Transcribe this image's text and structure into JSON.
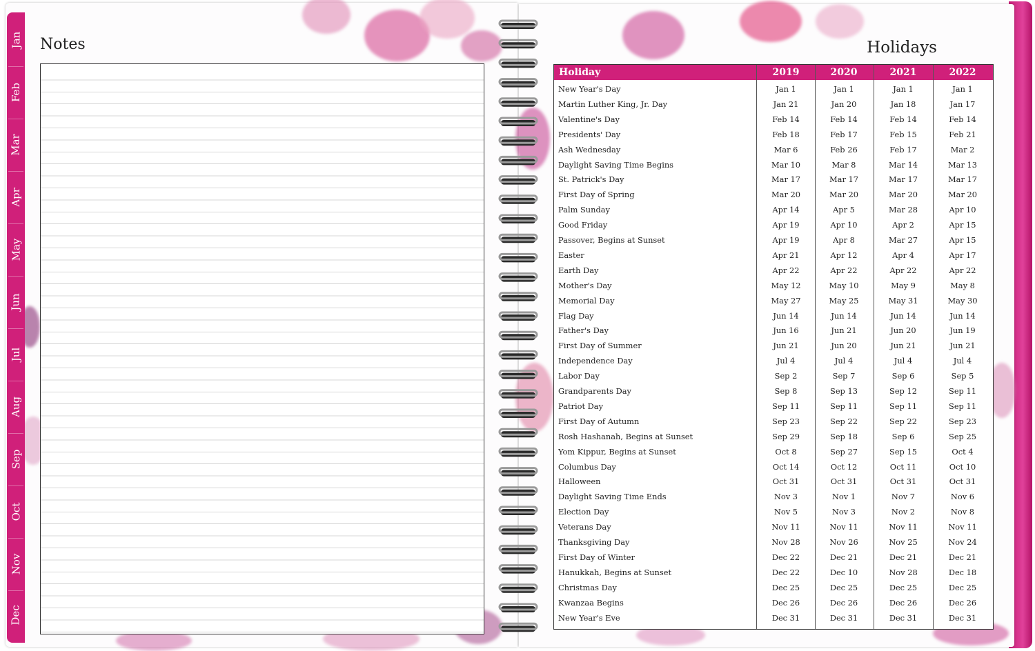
{
  "months": [
    "Jan",
    "Feb",
    "Mar",
    "Apr",
    "May",
    "Jun",
    "Jul",
    "Aug",
    "Sep",
    "Oct",
    "Nov",
    "Dec"
  ],
  "notes": {
    "title": "Notes"
  },
  "holidays": {
    "title": "Holidays",
    "header": [
      "Holiday",
      "2019",
      "2020",
      "2021",
      "2022"
    ],
    "rows": [
      [
        "New Year's Day",
        "Jan 1",
        "Jan 1",
        "Jan 1",
        "Jan 1"
      ],
      [
        "Martin Luther King, Jr. Day",
        "Jan 21",
        "Jan 20",
        "Jan 18",
        "Jan 17"
      ],
      [
        "Valentine's Day",
        "Feb 14",
        "Feb 14",
        "Feb 14",
        "Feb 14"
      ],
      [
        "Presidents' Day",
        "Feb 18",
        "Feb 17",
        "Feb 15",
        "Feb 21"
      ],
      [
        "Ash Wednesday",
        "Mar 6",
        "Feb 26",
        "Feb 17",
        "Mar 2"
      ],
      [
        "Daylight Saving Time Begins",
        "Mar 10",
        "Mar 8",
        "Mar 14",
        "Mar 13"
      ],
      [
        "St. Patrick's Day",
        "Mar 17",
        "Mar 17",
        "Mar 17",
        "Mar 17"
      ],
      [
        "First Day of Spring",
        "Mar 20",
        "Mar 20",
        "Mar 20",
        "Mar 20"
      ],
      [
        "Palm Sunday",
        "Apr 14",
        "Apr 5",
        "Mar 28",
        "Apr 10"
      ],
      [
        "Good Friday",
        "Apr 19",
        "Apr 10",
        "Apr 2",
        "Apr 15"
      ],
      [
        "Passover, Begins at Sunset",
        "Apr 19",
        "Apr 8",
        "Mar 27",
        "Apr 15"
      ],
      [
        "Easter",
        "Apr 21",
        "Apr 12",
        "Apr 4",
        "Apr 17"
      ],
      [
        "Earth Day",
        "Apr 22",
        "Apr 22",
        "Apr 22",
        "Apr 22"
      ],
      [
        "Mother's Day",
        "May 12",
        "May 10",
        "May 9",
        "May 8"
      ],
      [
        "Memorial Day",
        "May 27",
        "May 25",
        "May 31",
        "May 30"
      ],
      [
        "Flag Day",
        "Jun 14",
        "Jun 14",
        "Jun 14",
        "Jun 14"
      ],
      [
        "Father's Day",
        "Jun 16",
        "Jun 21",
        "Jun 20",
        "Jun 19"
      ],
      [
        "First Day of Summer",
        "Jun 21",
        "Jun 20",
        "Jun 21",
        "Jun 21"
      ],
      [
        "Independence Day",
        "Jul 4",
        "Jul 4",
        "Jul 4",
        "Jul 4"
      ],
      [
        "Labor Day",
        "Sep 2",
        "Sep 7",
        "Sep 6",
        "Sep 5"
      ],
      [
        "Grandparents Day",
        "Sep 8",
        "Sep 13",
        "Sep 12",
        "Sep 11"
      ],
      [
        "Patriot Day",
        "Sep 11",
        "Sep 11",
        "Sep 11",
        "Sep 11"
      ],
      [
        "First Day of Autumn",
        "Sep 23",
        "Sep 22",
        "Sep 22",
        "Sep 23"
      ],
      [
        "Rosh Hashanah, Begins at Sunset",
        "Sep 29",
        "Sep 18",
        "Sep 6",
        "Sep 25"
      ],
      [
        "Yom Kippur, Begins at Sunset",
        "Oct 8",
        "Sep 27",
        "Sep 15",
        "Oct 4"
      ],
      [
        "Columbus Day",
        "Oct 14",
        "Oct 12",
        "Oct 11",
        "Oct 10"
      ],
      [
        "Halloween",
        "Oct 31",
        "Oct 31",
        "Oct 31",
        "Oct 31"
      ],
      [
        "Daylight Saving Time Ends",
        "Nov 3",
        "Nov 1",
        "Nov 7",
        "Nov 6"
      ],
      [
        "Election Day",
        "Nov 5",
        "Nov 3",
        "Nov 2",
        "Nov 8"
      ],
      [
        "Veterans Day",
        "Nov 11",
        "Nov 11",
        "Nov 11",
        "Nov 11"
      ],
      [
        "Thanksgiving Day",
        "Nov 28",
        "Nov 26",
        "Nov 25",
        "Nov 24"
      ],
      [
        "First Day of Winter",
        "Dec 22",
        "Dec 21",
        "Dec 21",
        "Dec 21"
      ],
      [
        "Hanukkah, Begins at Sunset",
        "Dec 22",
        "Dec 10",
        "Nov 28",
        "Dec 18"
      ],
      [
        "Christmas Day",
        "Dec 25",
        "Dec 25",
        "Dec 25",
        "Dec 25"
      ],
      [
        "Kwanzaa Begins",
        "Dec 26",
        "Dec 26",
        "Dec 26",
        "Dec 26"
      ],
      [
        "New Year's Eve",
        "Dec 31",
        "Dec 31",
        "Dec 31",
        "Dec 31"
      ]
    ]
  },
  "colors": {
    "accent": "#d0207a",
    "blossom": "#c0307e"
  }
}
